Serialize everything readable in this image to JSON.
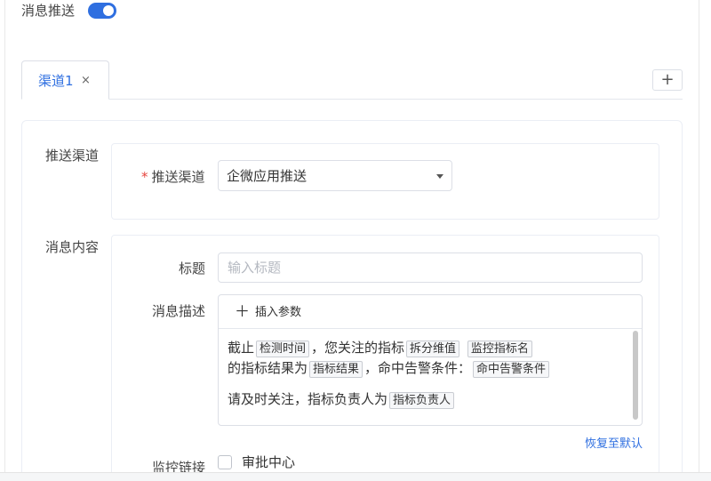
{
  "push": {
    "label": "消息推送",
    "enabled": true,
    "accent_color": "#2f6fe0"
  },
  "tabs": [
    {
      "label": "渠道1",
      "close_icon": "×"
    }
  ],
  "add_tab": {
    "icon": "+"
  },
  "channel_section": {
    "label": "推送渠道",
    "field_label": "推送渠道",
    "required_mark": "*",
    "select_value": "企微应用推送"
  },
  "content_section": {
    "label": "消息内容",
    "title_label": "标题",
    "title_placeholder": "输入标题",
    "title_value": "",
    "desc_label": "消息描述",
    "insert_param": "插入参数",
    "insert_icon": "＋",
    "desc_line1": {
      "t1": "截止",
      "tag1": "检测时间",
      "t2": "，您关注的指标",
      "tag2": "拆分维值",
      "tag3": "监控指标名"
    },
    "desc_line2": {
      "t1": "的指标结果为",
      "tag1": "指标结果",
      "t2": "，命中告警条件：",
      "tag2": "命中告警条件"
    },
    "desc_line3": {
      "t1": "请及时关注，指标负责人为",
      "tag1": "指标负责人"
    },
    "restore_default": "恢复至默认"
  },
  "monitor": {
    "label": "监控链接",
    "checkbox_label": "审批中心",
    "checked": false
  }
}
